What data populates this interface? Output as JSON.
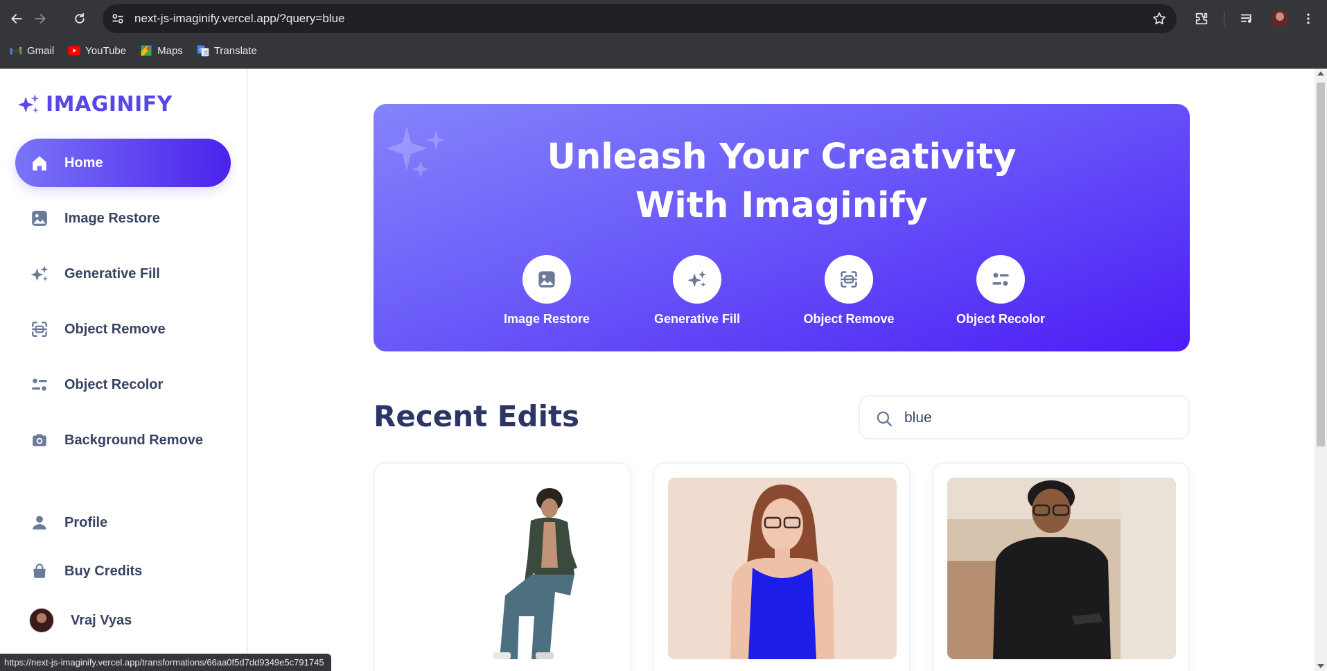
{
  "browser": {
    "url": "next-js-imaginify.vercel.app/?query=blue",
    "bookmarks": [
      {
        "label": "Gmail",
        "icon": "gmail-icon"
      },
      {
        "label": "YouTube",
        "icon": "youtube-icon"
      },
      {
        "label": "Maps",
        "icon": "maps-icon"
      },
      {
        "label": "Translate",
        "icon": "translate-icon"
      }
    ],
    "status_url": "https://next-js-imaginify.vercel.app/transformations/66aa0f5d7dd9349e5c791745"
  },
  "sidebar": {
    "logo_text": "IMAGINIFY",
    "nav": [
      {
        "label": "Home",
        "icon": "home-icon",
        "active": true
      },
      {
        "label": "Image Restore",
        "icon": "image-icon"
      },
      {
        "label": "Generative Fill",
        "icon": "stars-icon"
      },
      {
        "label": "Object Remove",
        "icon": "scan-icon"
      },
      {
        "label": "Object Recolor",
        "icon": "filter-icon"
      },
      {
        "label": "Background Remove",
        "icon": "camera-icon"
      }
    ],
    "bottom_nav": [
      {
        "label": "Profile",
        "icon": "profile-icon"
      },
      {
        "label": "Buy Credits",
        "icon": "bag-icon"
      }
    ],
    "user_name": "Vraj Vyas"
  },
  "banner": {
    "title_line1": "Unleash Your Creativity",
    "title_line2": "With Imaginify",
    "tools": [
      {
        "label": "Image Restore",
        "icon": "image-icon"
      },
      {
        "label": "Generative Fill",
        "icon": "stars-icon"
      },
      {
        "label": "Object Remove",
        "icon": "scan-icon"
      },
      {
        "label": "Object Recolor",
        "icon": "filter-icon"
      }
    ]
  },
  "recent": {
    "title": "Recent Edits",
    "search_value": "blue"
  },
  "colors": {
    "brand": "#5746e8",
    "banner_start": "#8583fb",
    "banner_end": "#4c1cf5",
    "text_dark": "#2b3566"
  }
}
